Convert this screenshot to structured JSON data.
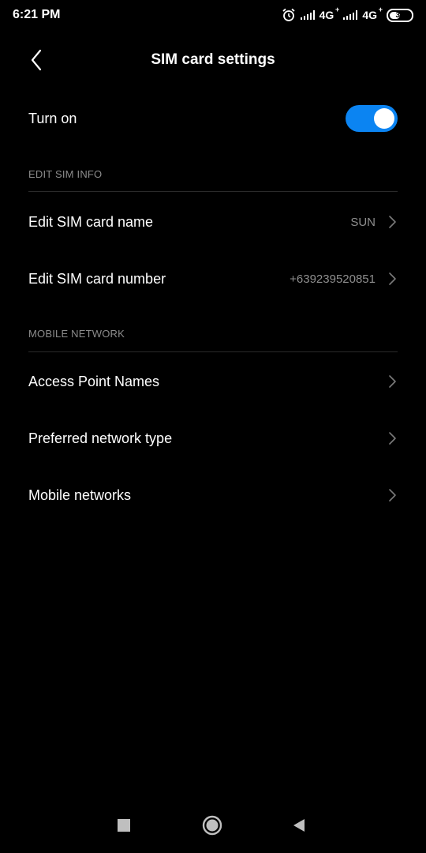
{
  "status_bar": {
    "time": "6:21 PM",
    "network_1": "4G",
    "network_2": "4G",
    "plus": "+",
    "battery": "39"
  },
  "header": {
    "title": "SIM card settings"
  },
  "turn_on": {
    "label": "Turn on",
    "enabled": true
  },
  "sections": {
    "edit_sim_info": "EDIT SIM INFO",
    "mobile_network": "MOBILE NETWORK"
  },
  "rows": {
    "sim_name": {
      "label": "Edit SIM card name",
      "value": "SUN"
    },
    "sim_number": {
      "label": "Edit SIM card number",
      "value": "+639239520851"
    },
    "apn": {
      "label": "Access Point Names"
    },
    "network_type": {
      "label": "Preferred network type"
    },
    "mobile_networks": {
      "label": "Mobile networks"
    }
  },
  "colors": {
    "background": "#000000",
    "accent": "#0b84f2",
    "secondary_text": "#8e8e8e"
  },
  "icons": {
    "back": "chevron-left-icon",
    "row_arrow": "chevron-right-icon",
    "alarm": "alarm-clock-icon",
    "nav_recents": "square-icon",
    "nav_home": "circle-icon",
    "nav_back": "triangle-icon"
  }
}
